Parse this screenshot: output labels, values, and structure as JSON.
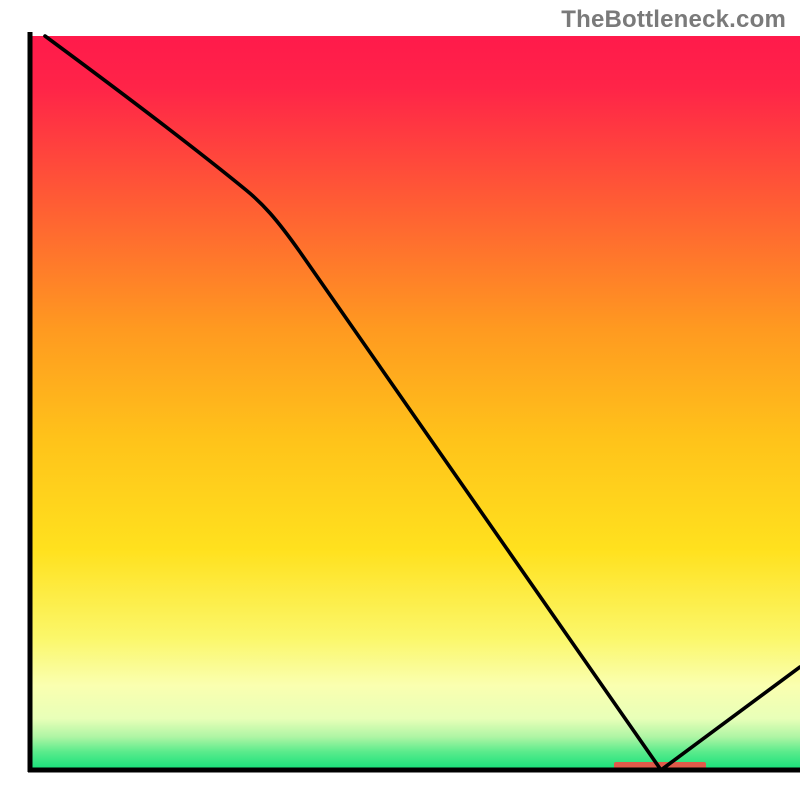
{
  "watermark": "TheBottleneck.com",
  "chart_data": {
    "type": "line",
    "title": "",
    "xlabel": "",
    "ylabel": "",
    "xlim": [
      0,
      100
    ],
    "ylim": [
      0,
      100
    ],
    "grid": false,
    "legend": false,
    "axes": {
      "left": true,
      "bottom": true,
      "right": false,
      "top": false,
      "ticks": false,
      "tick_labels": false
    },
    "series": [
      {
        "name": "curve",
        "color": "#000000",
        "x": [
          2,
          28,
          82,
          100
        ],
        "y": [
          100,
          79,
          0,
          14
        ],
        "note": "Values are approximate pixel-normalised readings; no axis labels are present in the source image."
      }
    ],
    "marker": {
      "name": "bottleneck-marker",
      "color": "#e05a4a",
      "x_range": [
        76,
        88
      ],
      "y": 0
    },
    "background_gradient": {
      "top_color": "#ff1a4b",
      "mid_color": "#ffd028",
      "low_band_color": "#faffb0",
      "bottom_color": "#14e07a"
    }
  }
}
